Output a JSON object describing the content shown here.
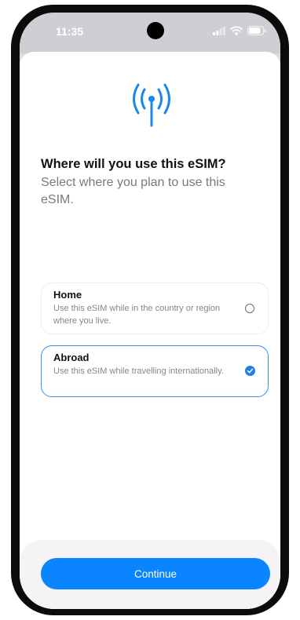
{
  "status_bar": {
    "time": "11:35"
  },
  "icons": {
    "header": "antenna-icon",
    "signal": "cellular-signal-icon",
    "wifi": "wifi-icon",
    "battery": "battery-icon",
    "checkmark": "checkmark-icon"
  },
  "header": {
    "title": "Where will you use this eSIM?",
    "subtitle": "Select where you plan to use this eSIM."
  },
  "options": [
    {
      "title": "Home",
      "description": "Use this eSIM while in the country or region where you live.",
      "selected": false
    },
    {
      "title": "Abroad",
      "description": "Use this eSIM while travelling internationally.",
      "selected": true
    }
  ],
  "footer": {
    "continue_label": "Continue"
  },
  "colors": {
    "accent": "#0a84ff",
    "selected_border": "#2f8ef0",
    "text_primary": "#111111",
    "text_secondary": "#7a7a7e"
  }
}
